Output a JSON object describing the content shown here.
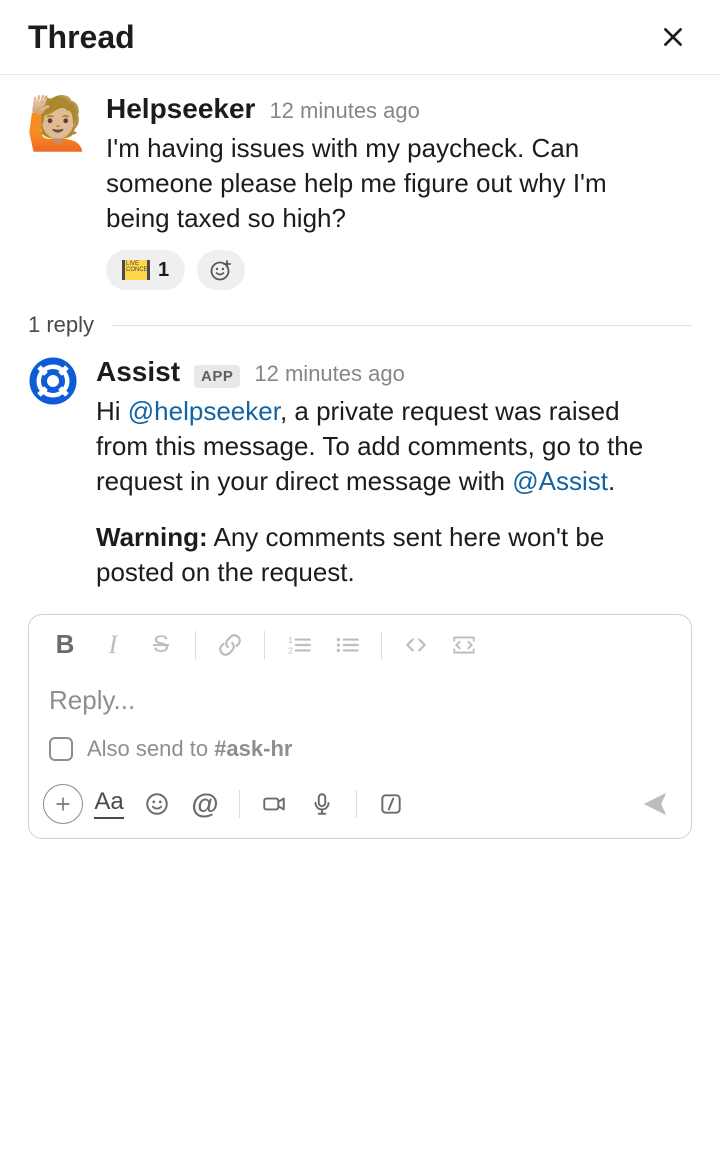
{
  "header": {
    "title": "Thread"
  },
  "messages": {
    "original": {
      "author": "Helpseeker",
      "timestamp": "12 minutes ago",
      "avatar_emoji": "🙋🏼",
      "text": "I'm having issues with my paycheck. Can someone please help me figure out why I'm being taxed so high?",
      "reactions": {
        "ticket": {
          "count": "1"
        }
      }
    },
    "reply_count_label": "1 reply",
    "reply1": {
      "author": "Assist",
      "app_badge": "APP",
      "timestamp": "12 minutes ago",
      "text_pre": "Hi ",
      "mention1": "@helpseeker",
      "text_mid": ",  a private request was raised from this message. To add comments, go to the request in your direct message with ",
      "mention2": "@Assist",
      "text_post": ".",
      "warning_label": "Warning:",
      "warning_text": " Any comments sent here won't be posted on the request."
    }
  },
  "compose": {
    "placeholder": "Reply...",
    "also_send_pre": "Also send to ",
    "also_send_channel": "#ask-hr"
  }
}
